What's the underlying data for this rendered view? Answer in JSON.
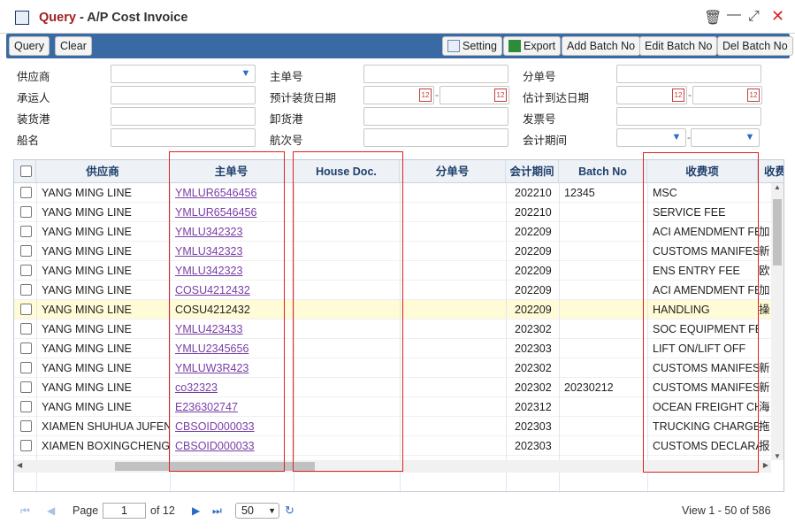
{
  "window": {
    "title_prefix": "Query",
    "title_rest": " - A/P Cost Invoice"
  },
  "toolbar": {
    "query": "Query",
    "clear": "Clear",
    "setting": "Setting",
    "export": "Export",
    "add_batch": "Add Batch No",
    "edit_batch": "Edit Batch No",
    "del_batch": "Del Batch No"
  },
  "form": {
    "supplier": "供应商",
    "carrier": "承运人",
    "pol": "装货港",
    "vessel": "船名",
    "mbl": "主单号",
    "etd": "预计装货日期",
    "pod": "卸货港",
    "voyage": "航次号",
    "hbl": "分单号",
    "eta": "估计到达日期",
    "invoice": "发票号",
    "period": "会计期间"
  },
  "grid": {
    "headers": [
      "供应商",
      "主单号",
      "House Doc.",
      "分单号",
      "会计期间",
      "Batch No",
      "收费项",
      "收费"
    ],
    "rows": [
      {
        "supplier": "YANG MING LINE",
        "mbl": "YMLUR6546456",
        "period": "202210",
        "batch": "12345",
        "fee": "MSC",
        "extra": ""
      },
      {
        "supplier": "YANG MING LINE",
        "mbl": "YMLUR6546456",
        "period": "202210",
        "batch": "",
        "fee": "SERVICE FEE",
        "extra": ""
      },
      {
        "supplier": "YANG MING LINE",
        "mbl": "YMLU342323",
        "period": "202209",
        "batch": "",
        "fee": "ACI AMENDMENT FEE",
        "extra": "加"
      },
      {
        "supplier": "YANG MING LINE",
        "mbl": "YMLU342323",
        "period": "202209",
        "batch": "",
        "fee": "CUSTOMS MANIFEST",
        "extra": "新"
      },
      {
        "supplier": "YANG MING LINE",
        "mbl": "YMLU342323",
        "period": "202209",
        "batch": "",
        "fee": "ENS ENTRY FEE",
        "extra": "欧"
      },
      {
        "supplier": "YANG MING LINE",
        "mbl": "COSU4212432",
        "period": "202209",
        "batch": "",
        "fee": "ACI AMENDMENT FEE",
        "extra": "加"
      },
      {
        "supplier": "YANG MING LINE",
        "mbl": "COSU4212432",
        "period": "202209",
        "batch": "",
        "fee": "HANDLING",
        "extra": "操"
      },
      {
        "supplier": "YANG MING LINE",
        "mbl": "YMLU423433",
        "period": "202302",
        "batch": "",
        "fee": "SOC EQUIPMENT FEE",
        "extra": ""
      },
      {
        "supplier": "YANG MING LINE",
        "mbl": "YMLU2345656",
        "period": "202303",
        "batch": "",
        "fee": "LIFT ON/LIFT OFF",
        "extra": ""
      },
      {
        "supplier": "YANG MING LINE",
        "mbl": "YMLUW3R423",
        "period": "202302",
        "batch": "",
        "fee": "CUSTOMS MANIFEST",
        "extra": "新"
      },
      {
        "supplier": "YANG MING LINE",
        "mbl": "co32323",
        "period": "202302",
        "batch": "20230212",
        "fee": "CUSTOMS MANIFEST",
        "extra": "新"
      },
      {
        "supplier": "YANG MING LINE",
        "mbl": "E236302747",
        "period": "202312",
        "batch": "",
        "fee": "OCEAN FREIGHT CHARGE",
        "extra": "海"
      },
      {
        "supplier": "XIAMEN SHUHUA JUFENG",
        "mbl": "CBSOID000033",
        "period": "202303",
        "batch": "",
        "fee": "TRUCKING CHARGE",
        "extra": "拖"
      },
      {
        "supplier": "XIAMEN BOXINGCHENG SUPPLY",
        "mbl": "CBSOID000033",
        "period": "202303",
        "batch": "",
        "fee": "CUSTOMS DECLARATION",
        "extra": "报"
      }
    ]
  },
  "pager": {
    "page_label": "Page",
    "page": "1",
    "of_label": "of 12",
    "page_size": "50",
    "view": "View 1 - 50 of 586"
  }
}
